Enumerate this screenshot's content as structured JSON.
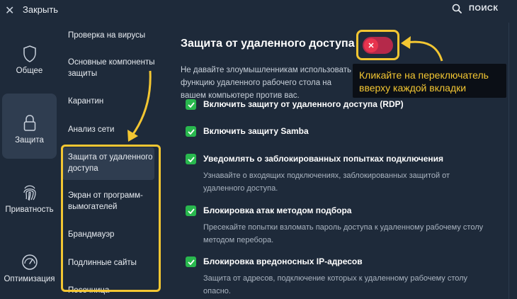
{
  "topbar": {
    "close_label": "Закрыть",
    "search_label": "ПОИСК"
  },
  "categories": [
    {
      "label": "Общее",
      "icon": "shield-icon"
    },
    {
      "label": "Защита",
      "icon": "lock-icon"
    },
    {
      "label": "Приватность",
      "icon": "fingerprint-icon"
    },
    {
      "label": "Оптимизация",
      "icon": "speedometer-icon"
    }
  ],
  "subnav": [
    "Проверка на вирусы",
    "Основные компоненты защиты",
    "Карантин",
    "Анализ сети",
    "Защита от удаленного доступа",
    "Экран от программ-вымогателей",
    "Брандмауэр",
    "Подлинные сайты",
    "Песочница"
  ],
  "main": {
    "title": "Защита от удаленного доступа",
    "description": "Не давайте злоумышленникам использовать функцию удаленного рабочего стола на вашем компьютере против вас.",
    "options": [
      {
        "label": "Включить защиту от удаленного доступа (RDP)",
        "desc": ""
      },
      {
        "label": "Включить защиту Samba",
        "desc": ""
      },
      {
        "label": "Уведомлять о заблокированных попытках подключения",
        "desc": "Узнавайте о входящих подключениях, заблокированных защитой от удаленного доступа."
      },
      {
        "label": "Блокировка атак методом подбора",
        "desc": "Пресекайте попытки взломать пароль доступа к удаленному рабочему столу методом перебора."
      },
      {
        "label": "Блокировка вредоносных IP-адресов",
        "desc": "Защита от адресов, подключение которых к удаленному рабочему столу опасно."
      }
    ]
  },
  "tooltip": {
    "line1": "Кликайте на переключатель",
    "line2": "вверху каждой вкладки"
  },
  "colors": {
    "background": "#1e2a3a",
    "accent_yellow": "#f3c632",
    "checkbox_green": "#29b84e",
    "toggle_red": "#e8344e"
  }
}
